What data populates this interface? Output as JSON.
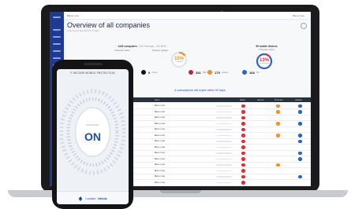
{
  "dashboard": {
    "topbar": {
      "left": "Menu / ooo",
      "right": "Menu / ooo"
    },
    "title": "Overview of all companies",
    "subtitle": "Lorem ipsum data set from 13 days",
    "computers": {
      "heading": "1440 computers",
      "heading_extra": "/ 200 Premium - 311 BOS",
      "protection_label": "Protection status",
      "software_label": "Software updates"
    },
    "mobile": {
      "heading": "55 mobile devices",
      "protection_label": "Protection status"
    },
    "donuts": [
      {
        "id": "software",
        "pct": "15%",
        "caption": "Outdated",
        "color": "#e8932b",
        "fraction": 0.15
      },
      {
        "id": "mobile",
        "pct": "13%",
        "caption": "Unprotected",
        "color": "#d8323f",
        "fraction": 0.13
      }
    ],
    "status_counts": [
      {
        "num": "0",
        "label": "Critical",
        "color": "#111111"
      },
      {
        "num": "331",
        "label": "Warnings",
        "color": "#c0283a"
      },
      {
        "num": "175",
        "label": "Updates",
        "color": "#e8932b"
      },
      {
        "num": "168",
        "label": "Info",
        "color": "#2b64c5"
      }
    ],
    "expiry_message": "4 subscriptions will expire within 90 days",
    "table": {
      "headers": [
        "Name",
        "Status",
        "Devices",
        "Protection",
        "Updates"
      ],
      "rows": [
        {
          "name": "Menu / ooo",
          "indicators": [
            "red",
            "orange",
            "blue"
          ]
        },
        {
          "name": "Menu / ooo",
          "indicators": [
            "red",
            "orange",
            "blue"
          ]
        },
        {
          "name": "Menu / ooo",
          "indicators": [
            "red",
            "",
            ""
          ]
        },
        {
          "name": "Menu / ooo",
          "indicators": [
            "red",
            "orange",
            "blue"
          ]
        },
        {
          "name": "Menu / ooo",
          "indicators": [
            "red",
            "",
            ""
          ]
        },
        {
          "name": "Menu / ooo",
          "indicators": [
            "red",
            "orange",
            "blue"
          ]
        },
        {
          "name": "Menu / ooo",
          "indicators": [
            "red",
            "",
            "blue"
          ]
        },
        {
          "name": "Menu / ooo",
          "indicators": [
            "red",
            "",
            ""
          ]
        },
        {
          "name": "Menu / ooo",
          "indicators": [
            "red",
            "",
            "blue"
          ]
        },
        {
          "name": "Menu / ooo",
          "indicators": [
            "red",
            "",
            "blue"
          ]
        },
        {
          "name": "Menu / ooo",
          "indicators": [
            "red",
            "orange",
            ""
          ]
        },
        {
          "name": "Menu / ooo",
          "indicators": [
            "red",
            "",
            ""
          ]
        },
        {
          "name": "Menu / ooo",
          "indicators": [
            "red",
            "",
            "blue"
          ]
        },
        {
          "name": "Menu / ooo",
          "indicators": [
            "red",
            "",
            ""
          ]
        }
      ]
    },
    "colors": {
      "red": "#d8323f",
      "orange": "#e8932b",
      "blue": "#2b64c5",
      "sidebar": "#1f3a93"
    }
  },
  "phone": {
    "app_title": "F-SECURE MOBILE PROTECTION",
    "status_caption": "PROTECTION",
    "status": "ON",
    "location_label": "Location:",
    "location_value": "Nebula"
  }
}
